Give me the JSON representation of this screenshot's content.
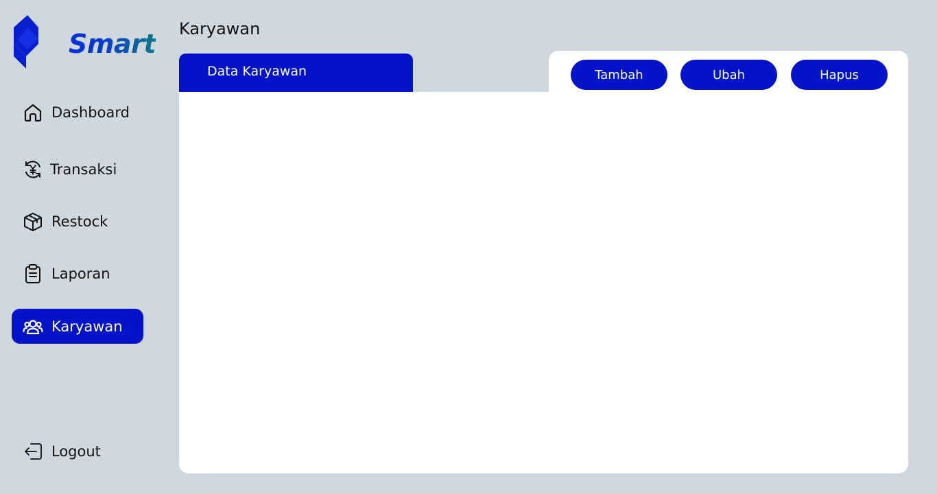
{
  "app": {
    "logo_text": "Smart",
    "colors": {
      "primary": "#0313C8",
      "background": "#CFD8DF",
      "panel": "#FFFFFF",
      "logo_gradient_end": "#0E7A88"
    }
  },
  "sidebar": {
    "items": [
      {
        "label": "Dashboard",
        "icon": "home-icon",
        "active": false
      },
      {
        "label": "Transaksi",
        "icon": "currency-exchange-icon",
        "active": false
      },
      {
        "label": "Restock",
        "icon": "box-icon",
        "active": false
      },
      {
        "label": "Laporan",
        "icon": "clipboard-icon",
        "active": false
      },
      {
        "label": "Karyawan",
        "icon": "users-icon",
        "active": true
      }
    ],
    "logout": {
      "label": "Logout",
      "icon": "logout-icon"
    }
  },
  "header": {
    "title": "Karyawan"
  },
  "panel": {
    "tab_label": "Data Karyawan",
    "actions": {
      "add": "Tambah",
      "edit": "Ubah",
      "delete": "Hapus"
    }
  }
}
